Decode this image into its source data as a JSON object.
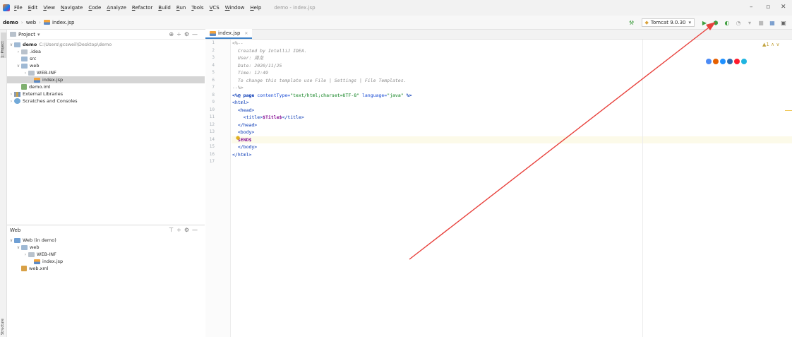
{
  "menu": {
    "items": [
      "File",
      "Edit",
      "View",
      "Navigate",
      "Code",
      "Analyze",
      "Refactor",
      "Build",
      "Run",
      "Tools",
      "VCS",
      "Window",
      "Help"
    ],
    "window_title": "demo - index.jsp"
  },
  "navbar": {
    "crumbs": [
      "demo",
      "web",
      "index.jsp"
    ],
    "run_config": "Tomcat 9.0.30"
  },
  "toolstrip": {
    "project_tab": "1: Project",
    "structure_tab": "Structure"
  },
  "project": {
    "header": "Project",
    "root": "demo",
    "root_path": "C:\\Users\\gcsweil\\Desktop\\demo",
    "items": [
      ".idea",
      "src",
      "web",
      "WEB-INF",
      "index.jsp",
      "demo.iml",
      "External Libraries",
      "Scratches and Consoles"
    ]
  },
  "web": {
    "header": "Web",
    "root": "Web (in demo)",
    "items": [
      "web",
      "WEB-INF",
      "index.jsp",
      "web.xml"
    ]
  },
  "editor": {
    "tab": "index.jsp",
    "warning": "▲1 ∧ ∨",
    "line_count": 17,
    "lines": {
      "l1": "<%--",
      "l2": "  Created by IntelliJ IDEA.",
      "l3": "  User: 周龙",
      "l4": "  Date: 2020/11/25",
      "l5": "  Time: 12:49",
      "l6": "  To change this template use File | Settings | File Templates.",
      "l7": "--%>",
      "l8_a": "<%@ ",
      "l8_b": "page ",
      "l8_c": "contentType=",
      "l8_d": "\"text/html;charset=UTF-8\"",
      "l8_e": " language=",
      "l8_f": "\"java\"",
      "l8_g": " %>",
      "l9": "<html>",
      "l10": "  <head>",
      "l11_a": "    <title>",
      "l11_b": "$Title$",
      "l11_c": "</title>",
      "l12": "  </head>",
      "l13": "  <body>",
      "l14": "  $END$",
      "l15": "  </body>",
      "l16": "</html>"
    }
  },
  "colors": {
    "accent": "#4083c9",
    "run_green": "#3e9e3e",
    "annotation_arrow": "#e8413c"
  }
}
